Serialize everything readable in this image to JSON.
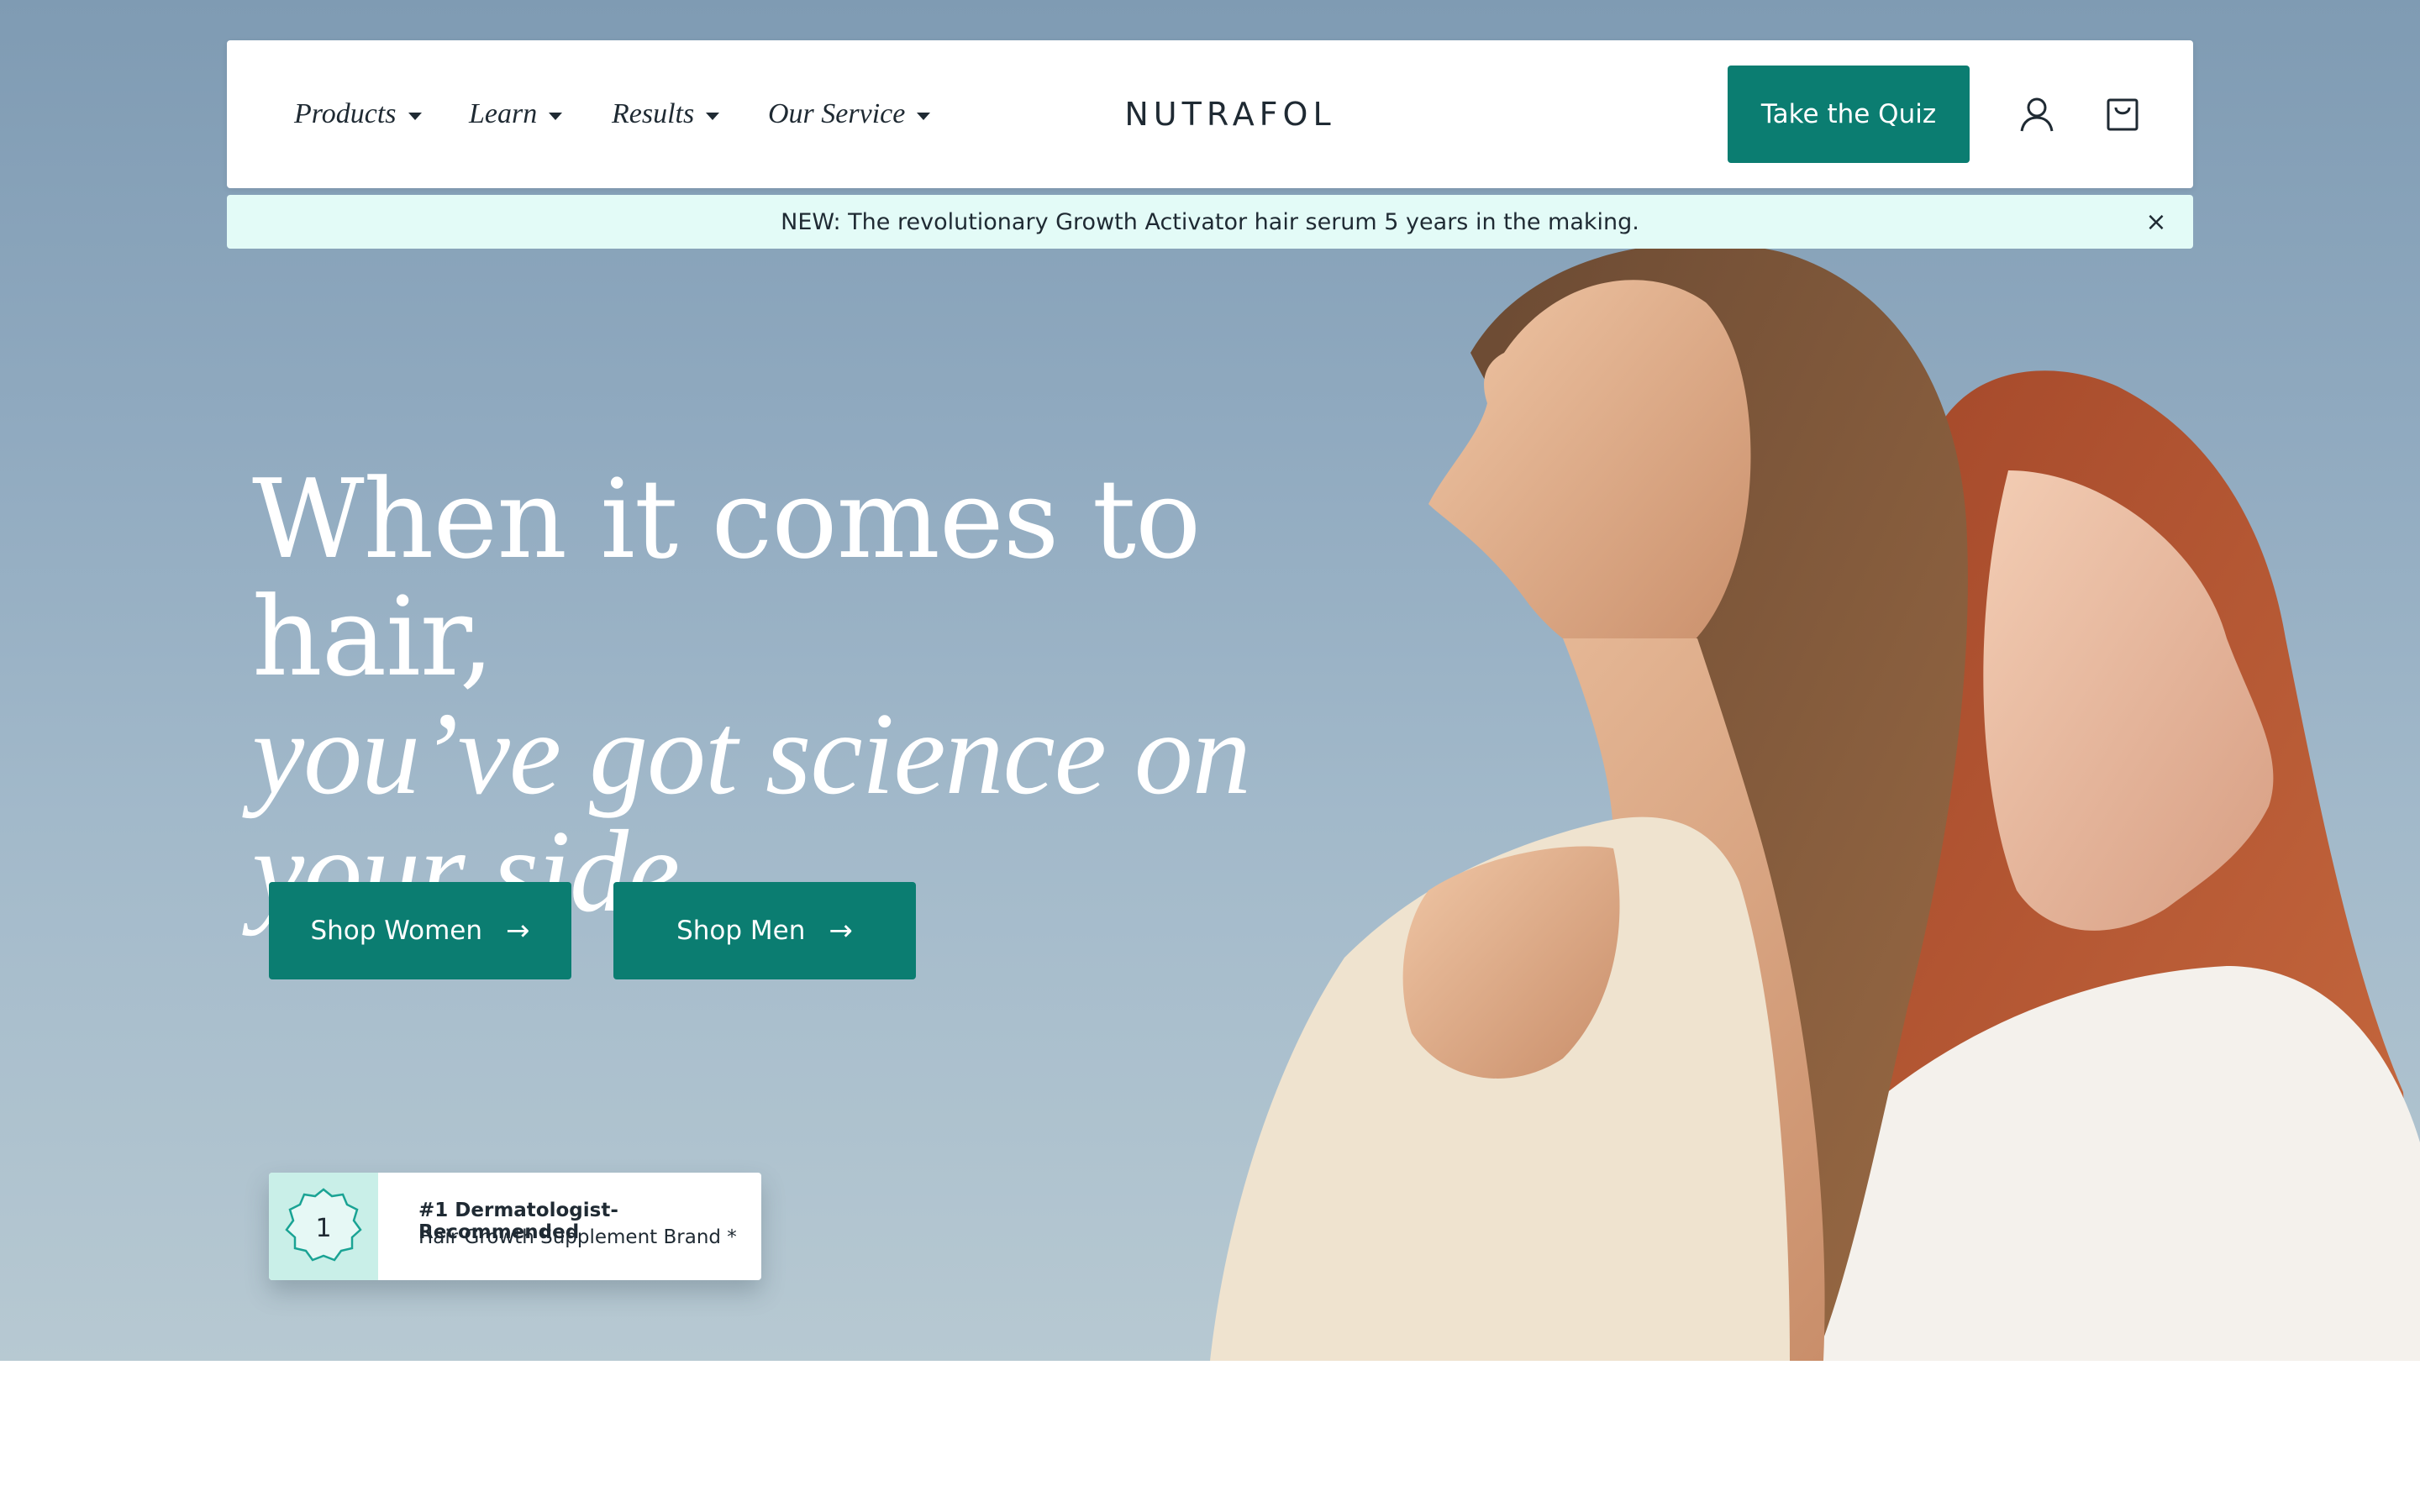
{
  "nav": {
    "items": [
      {
        "label": "Products"
      },
      {
        "label": "Learn"
      },
      {
        "label": "Results"
      },
      {
        "label": "Our Service"
      }
    ],
    "logo": "NUTRAFOL",
    "quiz_label": "Take the Quiz",
    "account_icon": "user-icon",
    "cart_icon": "shopping-bag-icon"
  },
  "announcement": {
    "text": "NEW: The revolutionary Growth Activator hair serum 5 years in the making.",
    "close_label": "×"
  },
  "hero": {
    "headline_line1": "When it comes to hair,",
    "headline_line2": "you’ve got science on",
    "headline_line3": "your side.",
    "cta_women": "Shop Women",
    "cta_men": "Shop Men",
    "cta_arrow": "→"
  },
  "badge": {
    "number": "1",
    "title": "#1 Dermatologist-Recommended",
    "subtitle": "Hair Growth Supplement Brand *"
  },
  "colors": {
    "accent": "#0b7d71",
    "announcement_bg": "#e3fbf7",
    "text": "#1f2a33"
  }
}
